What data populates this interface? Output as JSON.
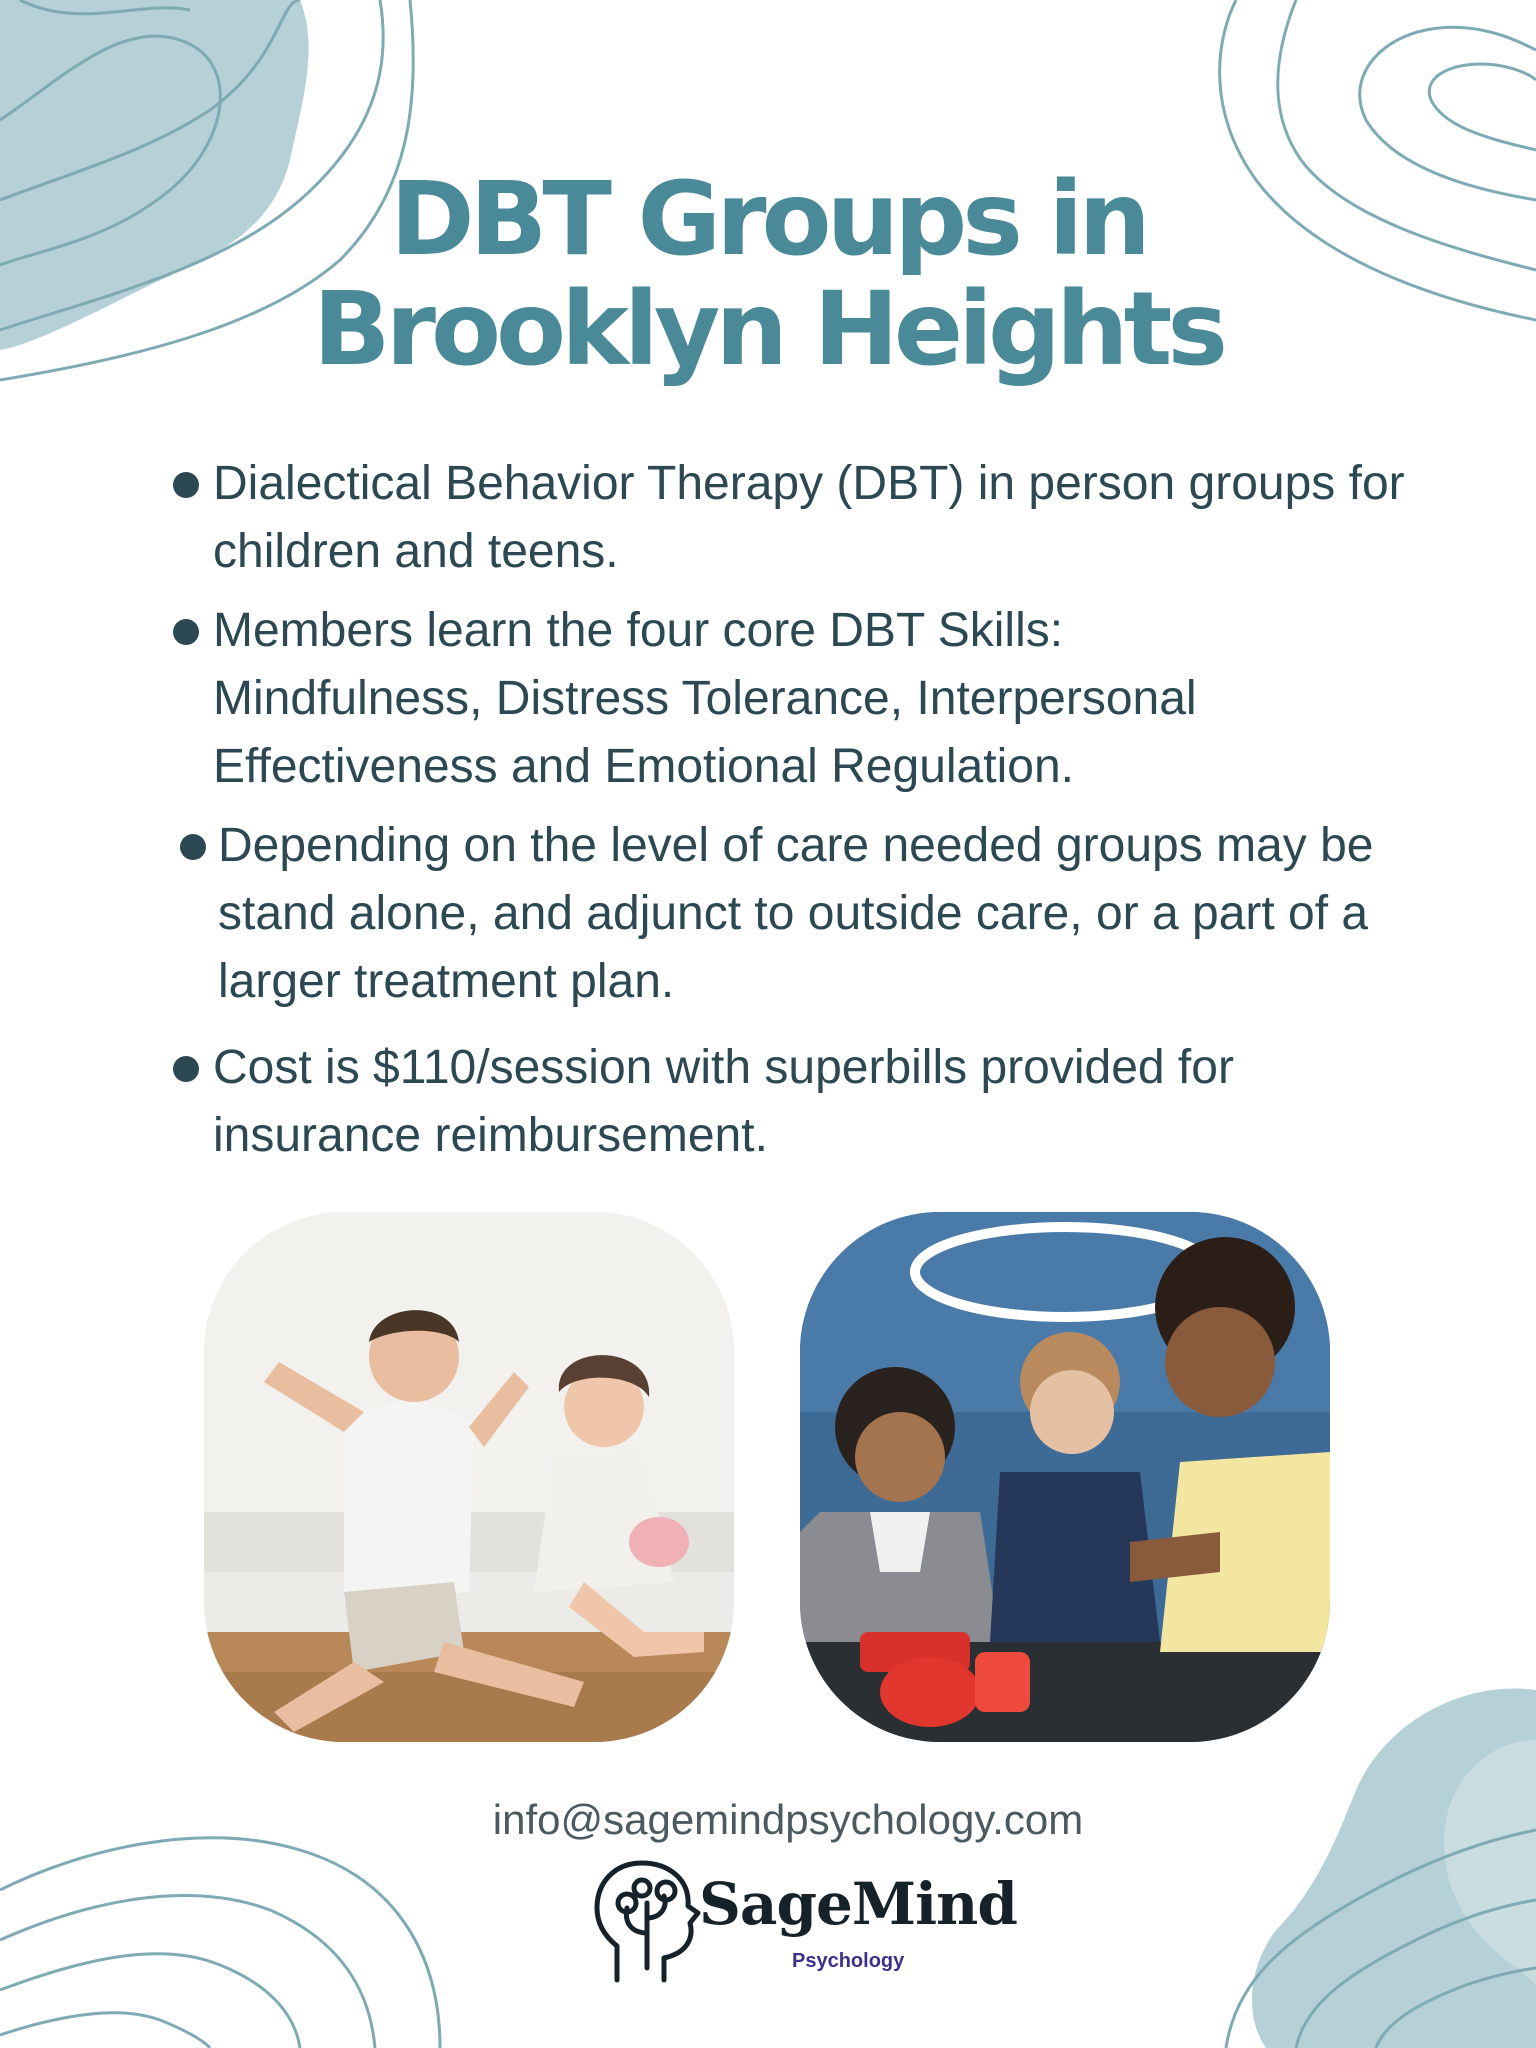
{
  "title": {
    "line1": "DBT Groups in",
    "line2": "Brooklyn Heights"
  },
  "bullets": [
    "Dialectical Behavior Therapy (DBT) in person groups for children and teens.",
    "Members learn the four core DBT Skills: Mindfulness, Distress Tolerance, Interpersonal Effectiveness and Emotional Regulation.",
    "Depending on the level of care needed groups may be stand alone, and adjunct to outside care, or a part of a larger treatment plan.",
    "Cost is $110/session with superbills provided for insurance reimbursement."
  ],
  "photos": [
    {
      "name": "photo-kids-making-faces"
    },
    {
      "name": "photo-teens-building-robot"
    }
  ],
  "contact": {
    "email": "info@sagemindpsychology.com"
  },
  "logo": {
    "word": "SageMind",
    "sub": "Psychology",
    "icon": "head-with-tree-icon"
  },
  "colors": {
    "title": "#4a8a98",
    "text": "#2c4852",
    "decoration": "#7eaab4",
    "logo_sub": "#3f2f88"
  }
}
